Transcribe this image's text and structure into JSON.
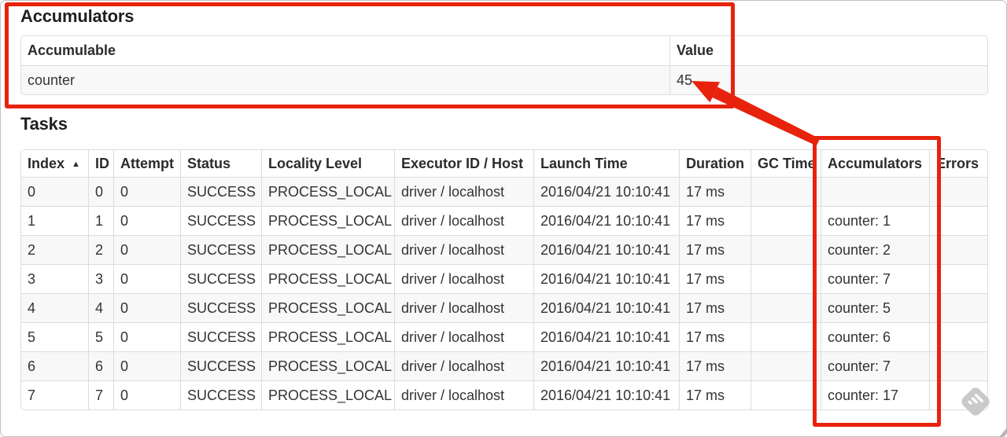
{
  "colors": {
    "annotation_red": "#e8230d",
    "table_border": "#dcdcdc",
    "stripe": "#f8f8f8",
    "text": "#333333",
    "watermark_gray": "#c9c9c9"
  },
  "accumulators_section": {
    "heading": "Accumulators",
    "table": {
      "headers": [
        "Accumulable",
        "Value"
      ],
      "rows": [
        {
          "accumulable": "counter",
          "value": "45"
        }
      ]
    }
  },
  "tasks_section": {
    "heading": "Tasks",
    "table": {
      "headers": [
        "Index",
        "ID",
        "Attempt",
        "Status",
        "Locality Level",
        "Executor ID / Host",
        "Launch Time",
        "Duration",
        "GC Time",
        "Accumulators",
        "Errors"
      ],
      "sort": {
        "column": "Index",
        "direction": "ascending",
        "glyph": "▲"
      },
      "rows": [
        {
          "index": "0",
          "id": "0",
          "attempt": "0",
          "status": "SUCCESS",
          "locality_level": "PROCESS_LOCAL",
          "executor_id_host": "driver / localhost",
          "launch_time": "2016/04/21 10:10:41",
          "duration": "17 ms",
          "gc_time": "",
          "accumulators": "",
          "errors": ""
        },
        {
          "index": "1",
          "id": "1",
          "attempt": "0",
          "status": "SUCCESS",
          "locality_level": "PROCESS_LOCAL",
          "executor_id_host": "driver / localhost",
          "launch_time": "2016/04/21 10:10:41",
          "duration": "17 ms",
          "gc_time": "",
          "accumulators": "counter: 1",
          "errors": ""
        },
        {
          "index": "2",
          "id": "2",
          "attempt": "0",
          "status": "SUCCESS",
          "locality_level": "PROCESS_LOCAL",
          "executor_id_host": "driver / localhost",
          "launch_time": "2016/04/21 10:10:41",
          "duration": "17 ms",
          "gc_time": "",
          "accumulators": "counter: 2",
          "errors": ""
        },
        {
          "index": "3",
          "id": "3",
          "attempt": "0",
          "status": "SUCCESS",
          "locality_level": "PROCESS_LOCAL",
          "executor_id_host": "driver / localhost",
          "launch_time": "2016/04/21 10:10:41",
          "duration": "17 ms",
          "gc_time": "",
          "accumulators": "counter: 7",
          "errors": ""
        },
        {
          "index": "4",
          "id": "4",
          "attempt": "0",
          "status": "SUCCESS",
          "locality_level": "PROCESS_LOCAL",
          "executor_id_host": "driver / localhost",
          "launch_time": "2016/04/21 10:10:41",
          "duration": "17 ms",
          "gc_time": "",
          "accumulators": "counter: 5",
          "errors": ""
        },
        {
          "index": "5",
          "id": "5",
          "attempt": "0",
          "status": "SUCCESS",
          "locality_level": "PROCESS_LOCAL",
          "executor_id_host": "driver / localhost",
          "launch_time": "2016/04/21 10:10:41",
          "duration": "17 ms",
          "gc_time": "",
          "accumulators": "counter: 6",
          "errors": ""
        },
        {
          "index": "6",
          "id": "6",
          "attempt": "0",
          "status": "SUCCESS",
          "locality_level": "PROCESS_LOCAL",
          "executor_id_host": "driver / localhost",
          "launch_time": "2016/04/21 10:10:41",
          "duration": "17 ms",
          "gc_time": "",
          "accumulators": "counter: 7",
          "errors": ""
        },
        {
          "index": "7",
          "id": "7",
          "attempt": "0",
          "status": "SUCCESS",
          "locality_level": "PROCESS_LOCAL",
          "executor_id_host": "driver / localhost",
          "launch_time": "2016/04/21 10:10:41",
          "duration": "17 ms",
          "gc_time": "",
          "accumulators": "counter: 17",
          "errors": ""
        }
      ]
    }
  },
  "annotations": {
    "rectangle_1_target": "Accumulators summary table",
    "rectangle_2_target": "Accumulators column",
    "arrow_points_to": "45"
  }
}
